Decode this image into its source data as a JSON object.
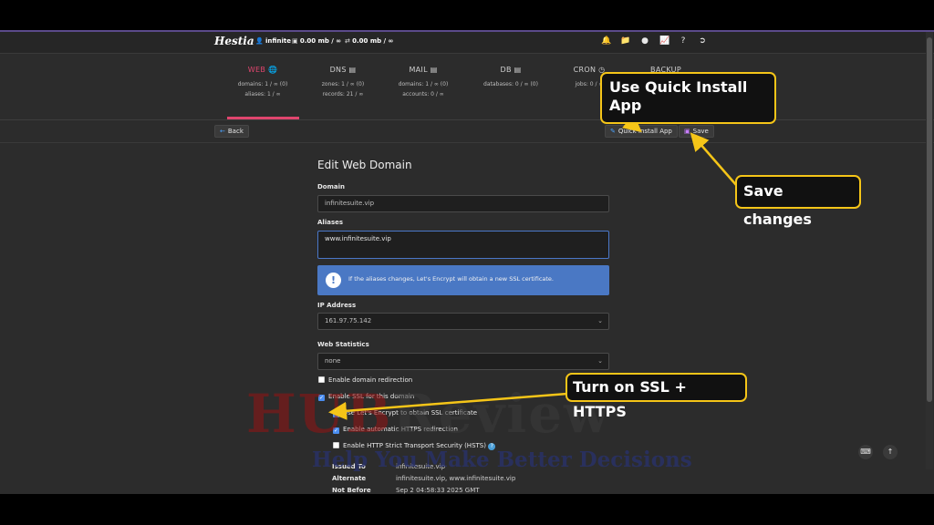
{
  "topbar": {
    "logo": "Hestia",
    "user": "infinite",
    "disk": "0.00 mb / ∞",
    "bandwidth": "0.00 mb / ∞",
    "icons": [
      "bell-icon",
      "folder-icon",
      "user-icon",
      "chart-icon",
      "help-icon",
      "logout-icon"
    ]
  },
  "tabs": [
    {
      "name": "WEB",
      "lines": [
        "domains: 1 / ∞ (0)",
        "aliases: 1 / ∞"
      ],
      "active": true
    },
    {
      "name": "DNS",
      "lines": [
        "zones: 1 / ∞ (0)",
        "records: 21 / ∞"
      ]
    },
    {
      "name": "MAIL",
      "lines": [
        "domains: 1 / ∞ (0)",
        "accounts: 0 / ∞"
      ]
    },
    {
      "name": "DB",
      "lines": [
        "databases: 0 / ∞ (0)"
      ]
    },
    {
      "name": "CRON",
      "lines": [
        "jobs: 0 / ∞"
      ]
    },
    {
      "name": "BACKUP",
      "lines": []
    }
  ],
  "toolbar": {
    "back_label": "Back",
    "quick_install_label": "Quick Install App",
    "save_label": "Save"
  },
  "form": {
    "title": "Edit Web Domain",
    "domain_label": "Domain",
    "domain_value": "infinitesuite.vip",
    "aliases_label": "Aliases",
    "aliases_value": "www.infinitesuite.vip",
    "alert_text": "If the aliases changes, Let's Encrypt will obtain a new SSL certificate.",
    "ip_label": "IP Address",
    "ip_value": "161.97.75.142",
    "stats_label": "Web Statistics",
    "stats_value": "none",
    "checkboxes": {
      "redirection": {
        "label": "Enable domain redirection",
        "checked": false
      },
      "ssl": {
        "label": "Enable SSL for this domain",
        "checked": true
      },
      "letsencrypt": {
        "label": "Use Let's Encrypt to obtain SSL certificate",
        "checked": true
      },
      "https_redirect": {
        "label": "Enable automatic HTTPS redirection",
        "checked": true
      },
      "hsts": {
        "label": "Enable HTTP Strict Transport Security (HSTS)",
        "checked": false
      }
    },
    "cert": {
      "issued_to_label": "Issued To",
      "issued_to_value": "infinitesuite.vip",
      "alternate_label": "Alternate",
      "alternate_value": "infinitesuite.vip, www.infinitesuite.vip",
      "not_before_label": "Not Before",
      "not_before_value": "Sep 2 04:58:33 2025 GMT"
    }
  },
  "watermark": {
    "line1_a": "HUB",
    "line1_b": "Review",
    "line2": "Help You Make Better Decisions"
  },
  "callouts": {
    "quick_install": "Use Quick Install App",
    "save": "Save changes",
    "ssl": "Turn on SSL + HTTPS"
  },
  "colors": {
    "accent": "#e0456e",
    "callout_border": "#f5c518",
    "alert_bg": "#4a78c4",
    "checkbox": "#4a8df0"
  }
}
